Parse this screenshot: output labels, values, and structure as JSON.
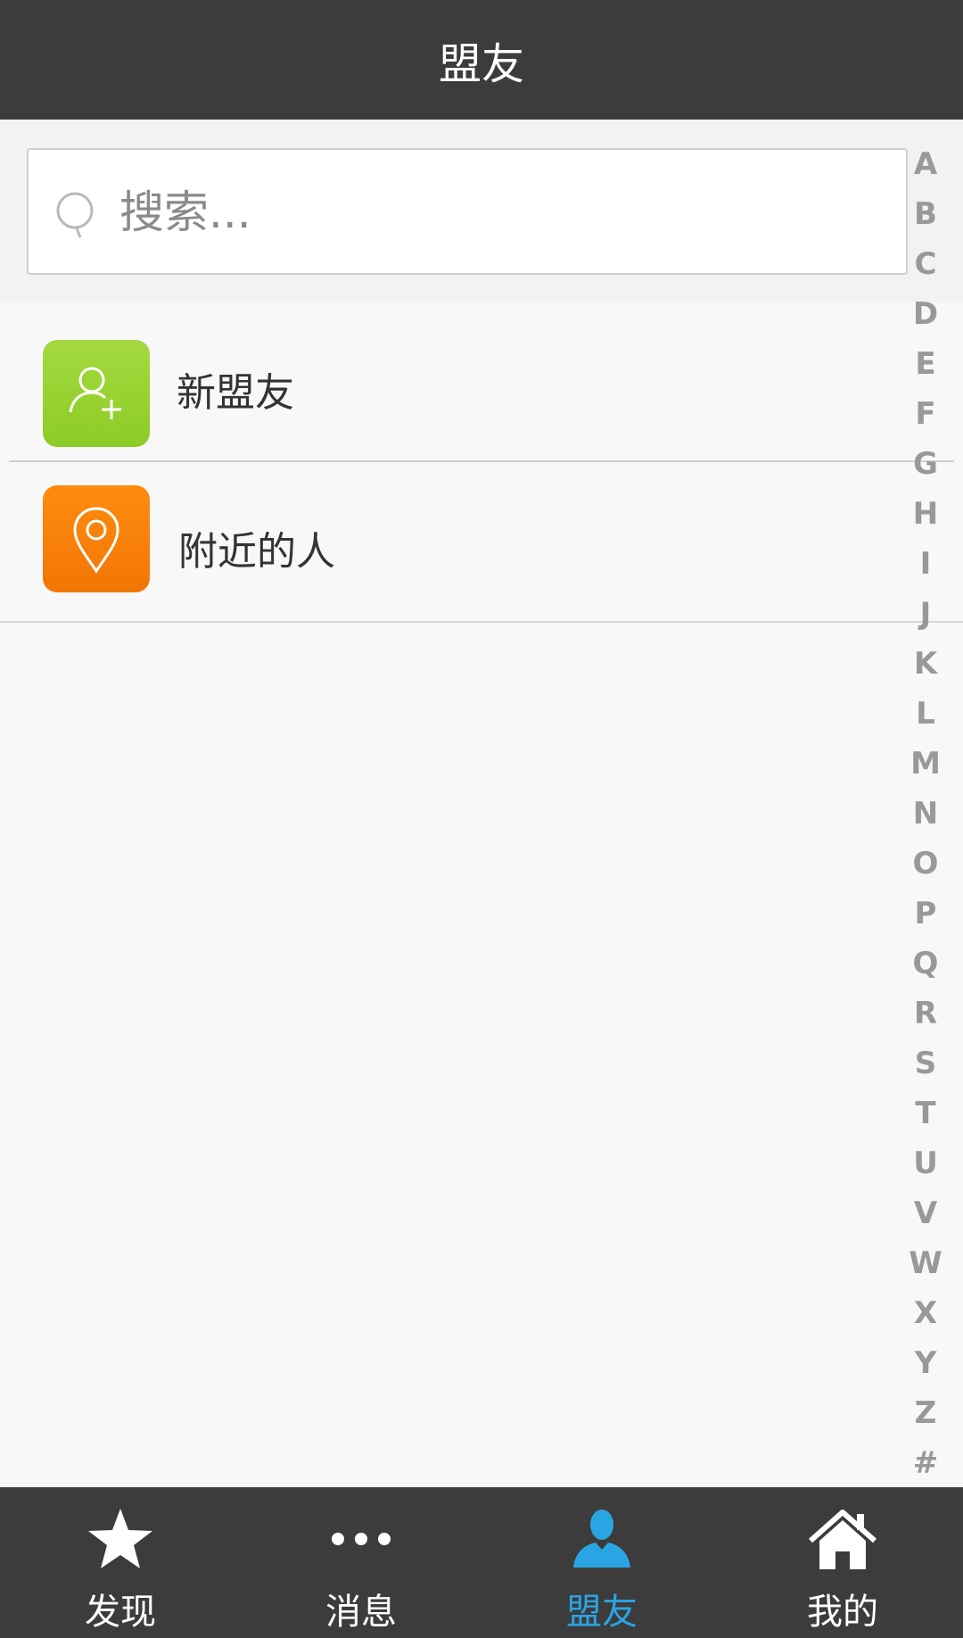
{
  "header": {
    "title": "盟友"
  },
  "search": {
    "placeholder": "搜索..."
  },
  "list": {
    "items": [
      {
        "label": "新盟友",
        "icon": "add-friend-icon",
        "color": "#93d02e"
      },
      {
        "label": "附近的人",
        "icon": "location-pin-icon",
        "color": "#f98009"
      }
    ]
  },
  "alphabet_index": [
    "A",
    "B",
    "C",
    "D",
    "E",
    "F",
    "G",
    "H",
    "I",
    "J",
    "K",
    "L",
    "M",
    "N",
    "O",
    "P",
    "Q",
    "R",
    "S",
    "T",
    "U",
    "V",
    "W",
    "X",
    "Y",
    "Z",
    "#"
  ],
  "tabbar": {
    "active_color": "#2aa5e4",
    "tabs": [
      {
        "label": "发现",
        "icon": "star-icon",
        "active": false
      },
      {
        "label": "消息",
        "icon": "more-dots-icon",
        "active": false
      },
      {
        "label": "盟友",
        "icon": "person-icon",
        "active": true
      },
      {
        "label": "我的",
        "icon": "home-icon",
        "active": false
      }
    ]
  }
}
